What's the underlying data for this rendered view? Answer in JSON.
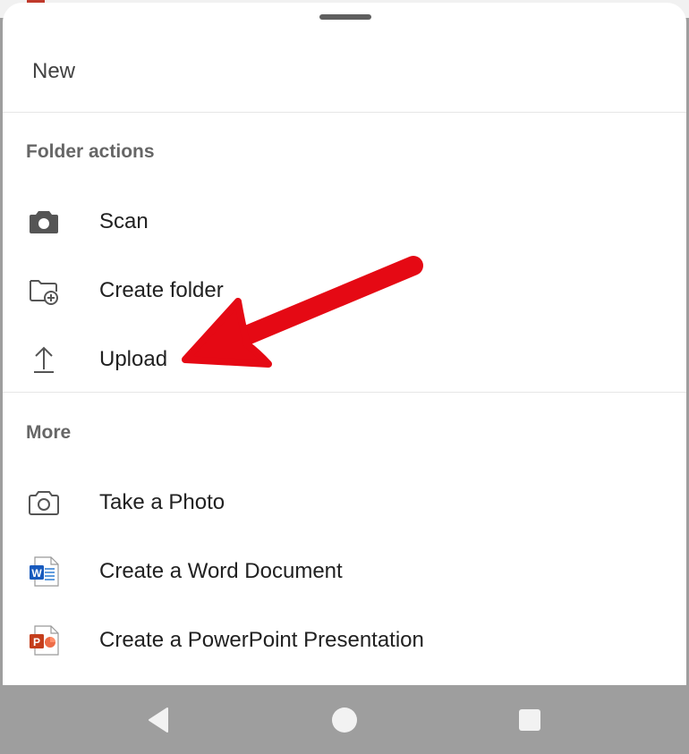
{
  "sheet": {
    "title": "New",
    "folder_actions": {
      "heading": "Folder actions",
      "items": [
        {
          "label": "Scan",
          "icon": "camera-filled-icon"
        },
        {
          "label": "Create folder",
          "icon": "folder-add-icon"
        },
        {
          "label": "Upload",
          "icon": "upload-icon"
        }
      ]
    },
    "more": {
      "heading": "More",
      "items": [
        {
          "label": "Take a Photo",
          "icon": "camera-outline-icon"
        },
        {
          "label": "Create a Word Document",
          "icon": "word-doc-icon"
        },
        {
          "label": "Create a PowerPoint Presentation",
          "icon": "powerpoint-icon"
        }
      ]
    }
  },
  "annotation": {
    "arrow_color": "#e50914",
    "points_to": "Upload"
  },
  "navbar": {
    "buttons": [
      "back",
      "home",
      "recents"
    ]
  },
  "colors": {
    "word": "#185abd",
    "powerpoint": "#c43e1c",
    "icon": "#555555"
  }
}
